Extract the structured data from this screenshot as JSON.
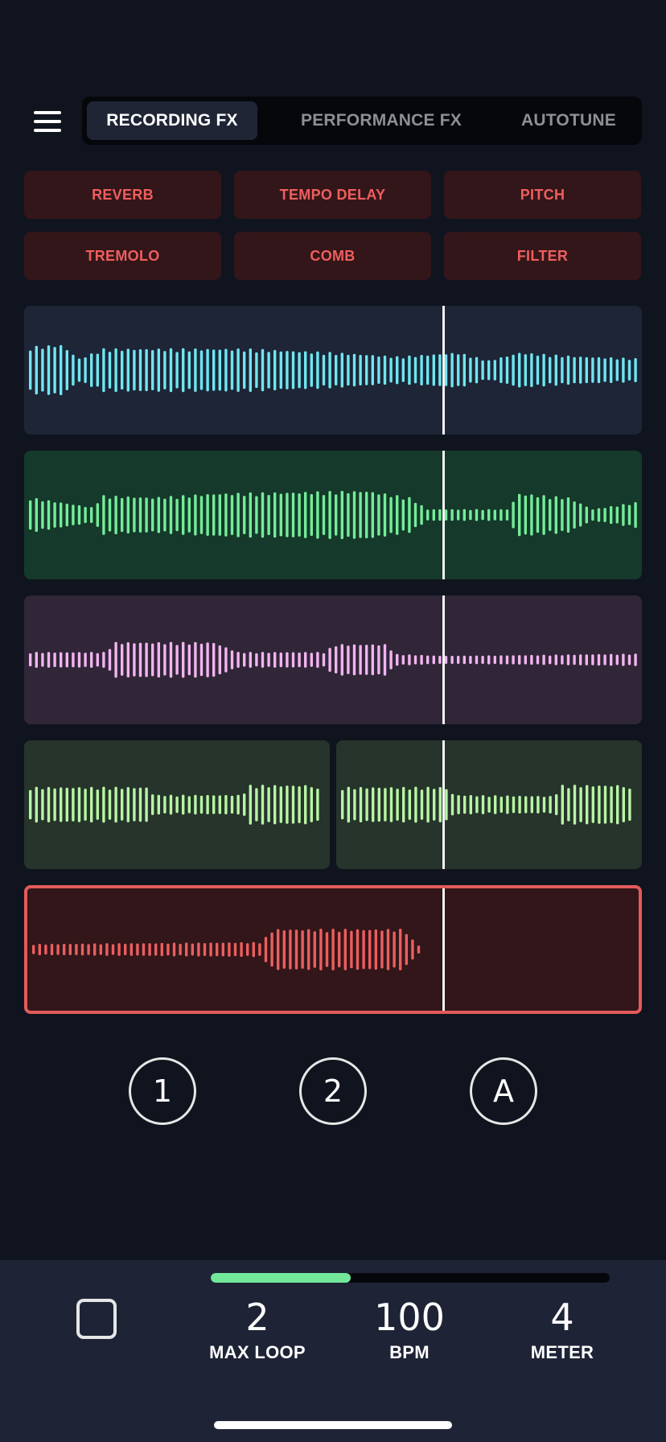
{
  "tabs": [
    {
      "label": "RECORDING FX",
      "active": true
    },
    {
      "label": "PERFORMANCE FX",
      "active": false
    },
    {
      "label": "AUTOTUNE",
      "active": false
    }
  ],
  "fx_buttons": [
    "REVERB",
    "TEMPO DELAY",
    "PITCH",
    "TREMOLO",
    "COMB",
    "FILTER"
  ],
  "tracks": [
    {
      "name": "track-1",
      "color": "#6fe6f0",
      "bg": "#1e2536"
    },
    {
      "name": "track-2",
      "color": "#74ec9a",
      "bg": "#15392a"
    },
    {
      "name": "track-3",
      "color": "#f2b4f0",
      "bg": "#302637"
    },
    {
      "name": "track-4a",
      "color": "#b8f5a4",
      "bg": "#26342c"
    },
    {
      "name": "track-4b",
      "color": "#b8f5a4",
      "bg": "#26342c"
    },
    {
      "name": "track-5",
      "color": "#ea5f5f",
      "bg": "#321619",
      "selected": true
    }
  ],
  "loop_buttons": [
    "1",
    "2",
    "A"
  ],
  "transport": {
    "progress": 0.35,
    "max_loop_value": "2",
    "max_loop_label": "MAX LOOP",
    "bpm_value": "100",
    "bpm_label": "BPM",
    "meter_value": "4",
    "meter_label": "METER"
  },
  "colors": {
    "background": "#10141f",
    "accent": "#f05e5e",
    "progress": "#72e79a",
    "panel": "#1e2436"
  }
}
